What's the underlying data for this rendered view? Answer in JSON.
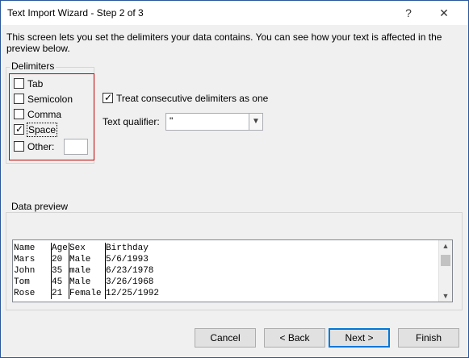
{
  "window": {
    "title": "Text Import Wizard - Step 2 of 3",
    "help_glyph": "?",
    "close_glyph": "✕"
  },
  "intro_text": "This screen lets you set the delimiters your data contains.  You can see how your text is affected in the preview below.",
  "delimiters": {
    "group_label": "Delimiters",
    "tab": {
      "label": "Tab",
      "checked": false
    },
    "semicolon": {
      "label": "Semicolon",
      "checked": false
    },
    "comma": {
      "label": "Comma",
      "checked": false
    },
    "space": {
      "label": "Space",
      "checked": true
    },
    "other": {
      "label": "Other:",
      "checked": false,
      "value": ""
    }
  },
  "options": {
    "consecutive_label": "Treat consecutive delimiters as one",
    "consecutive_checked": true,
    "qualifier_label": "Text qualifier:",
    "qualifier_value": "\""
  },
  "preview": {
    "group_label": "Data preview",
    "rows": [
      [
        "Name",
        "Age",
        "Sex",
        "Birthday"
      ],
      [
        "Mars",
        "20",
        "Male",
        "5/6/1993"
      ],
      [
        "John",
        "35",
        "male",
        "6/23/1978"
      ],
      [
        "Tom",
        "45",
        "Male",
        "3/26/1968"
      ],
      [
        "Rose",
        "21",
        "Female",
        "12/25/1992"
      ]
    ]
  },
  "buttons": {
    "cancel": "Cancel",
    "back": "< Back",
    "next": "Next >",
    "finish": "Finish"
  },
  "colors": {
    "highlight_border": "#c00000",
    "default_button_border": "#0078d7",
    "window_border": "#2b579a"
  }
}
